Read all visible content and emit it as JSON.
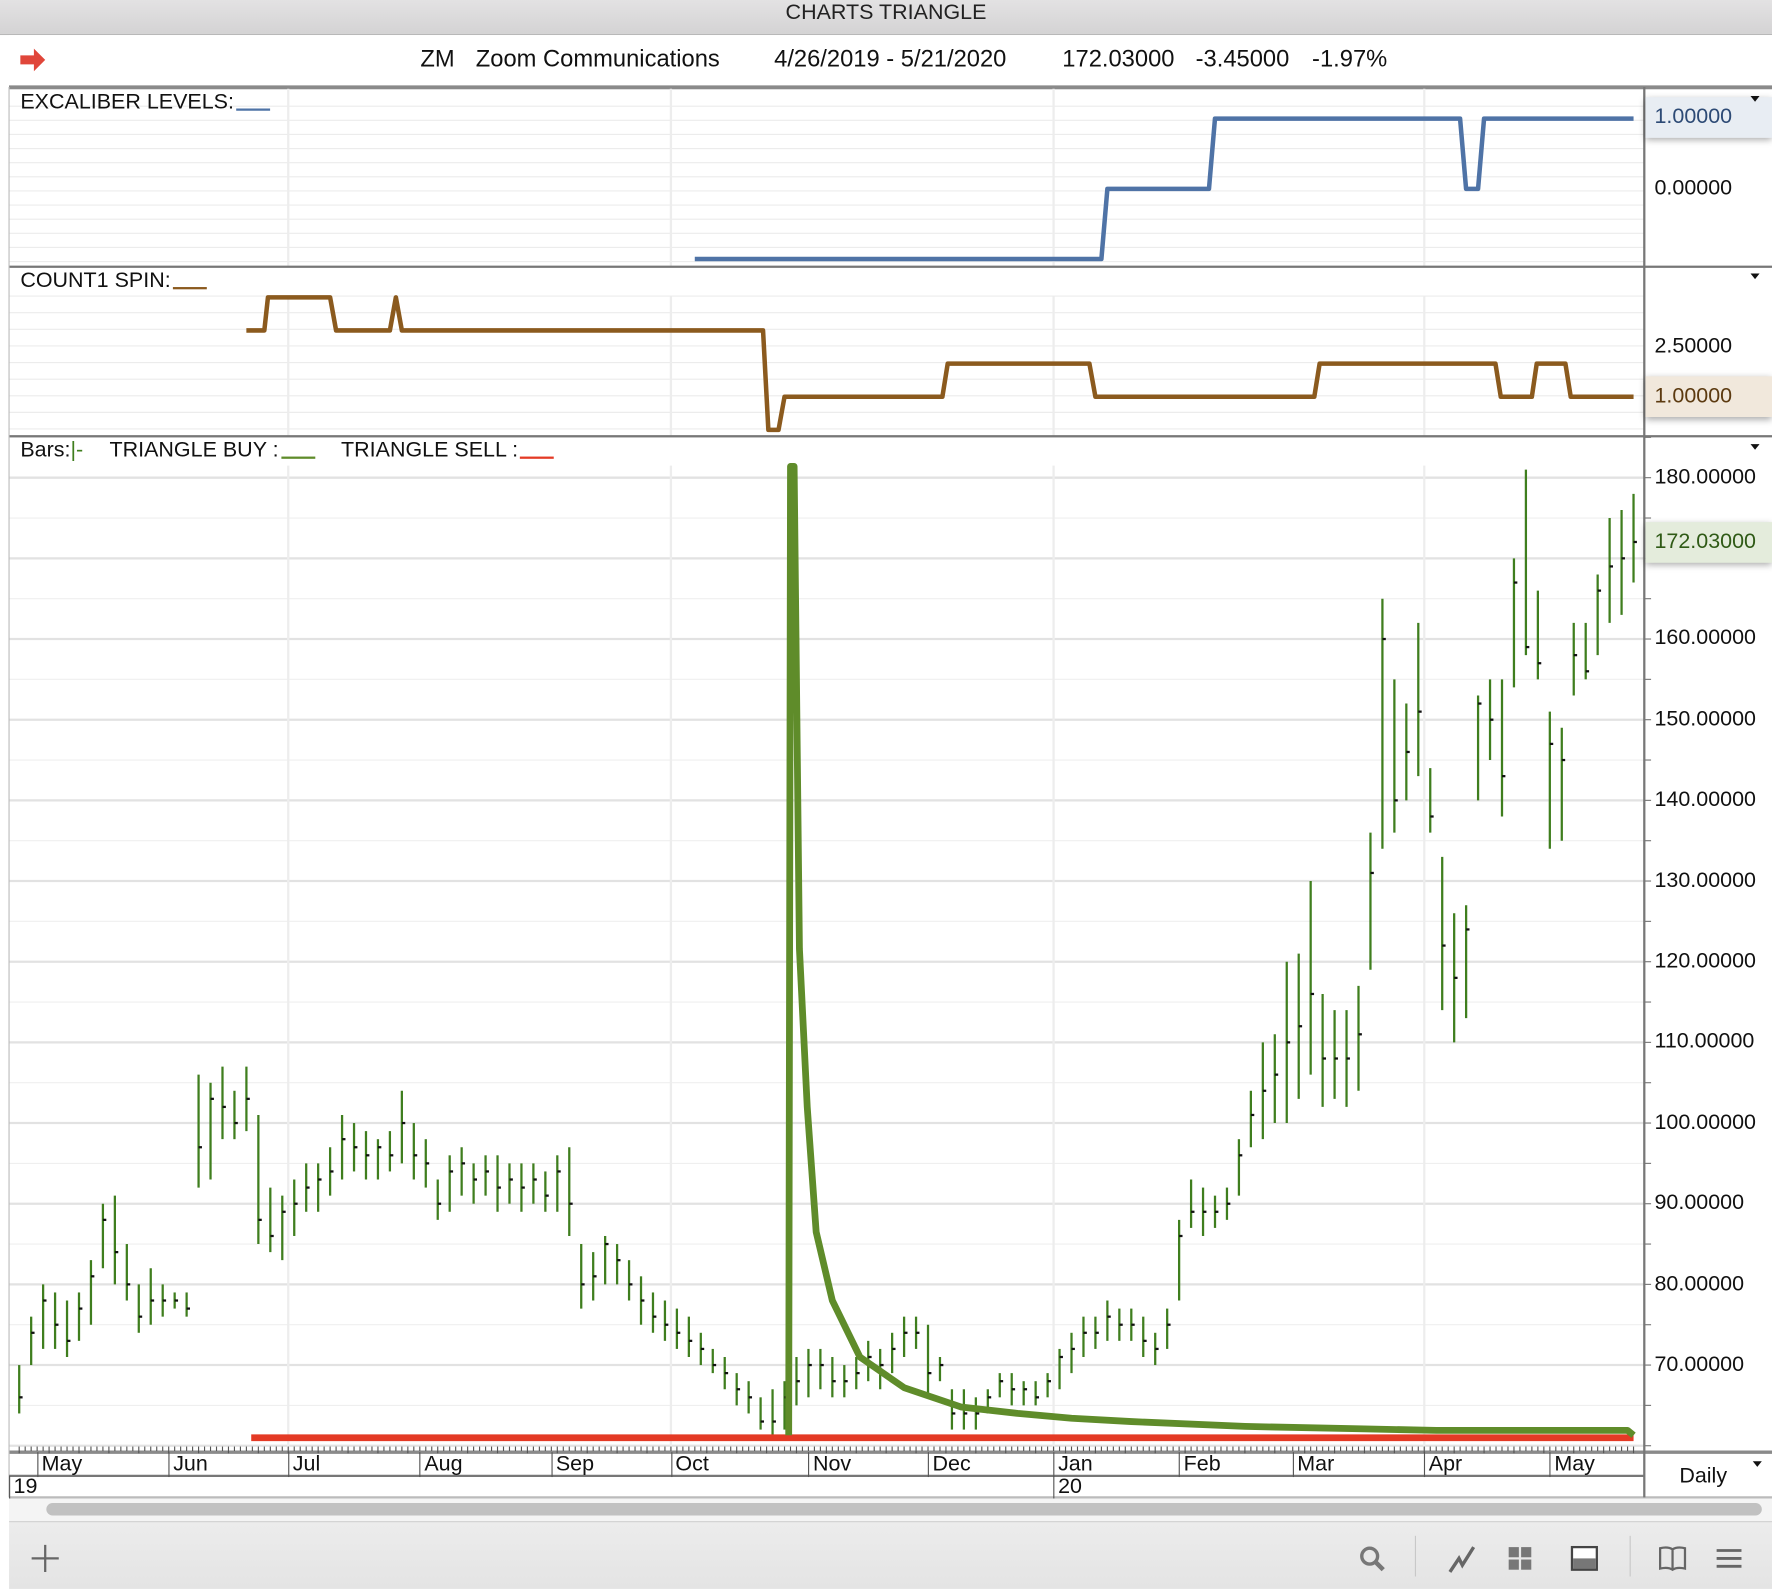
{
  "window_title": "CHARTS TRIANGLE",
  "header": {
    "symbol": "ZM",
    "company": "Zoom Communications",
    "date_range": "4/26/2019 - 5/21/2020",
    "last": "172.03000",
    "change": "-3.45000",
    "change_pct": "-1.97%"
  },
  "panes": {
    "excaliber": {
      "label": "EXCALIBER LEVELS:",
      "axis_labels": [
        "1.00000",
        "0.00000"
      ],
      "current": "1.00000",
      "color": "#4f73a6"
    },
    "count1": {
      "label": "COUNT1 SPIN:",
      "axis_labels": [
        "2.50000",
        "1.00000"
      ],
      "current": "1.00000",
      "color": "#8b5a1e"
    },
    "main": {
      "bars_label": "Bars:",
      "bars_glyph": "|-",
      "buy_label": "TRIANGLE BUY :",
      "sell_label": "TRIANGLE SELL :",
      "current": "172.03000"
    }
  },
  "periodicity": "Daily",
  "colors": {
    "bars": "#3f7e1e",
    "buy": "#5f8c2a",
    "sell": "#e43a25",
    "excaliber": "#4f73a6",
    "count": "#8b5a1e"
  },
  "toolbar": {
    "icons": [
      "plus-icon",
      "search-icon",
      "line-chart-icon",
      "grid-icon",
      "panel-icon",
      "book-icon",
      "menu-icon"
    ]
  },
  "chart_data": [
    {
      "type": "line",
      "title": "EXCALIBER LEVELS",
      "x_unit": "trading day index from 4/26/2019",
      "xlim": [
        -1.7,
        271.8
      ],
      "ylim": [
        -1.11,
        1.435
      ],
      "ticks": [
        1,
        0
      ],
      "points": [
        [
          113,
          -1
        ],
        [
          181,
          -1
        ],
        [
          182,
          0
        ],
        [
          199,
          0
        ],
        [
          200,
          1
        ],
        [
          241,
          1
        ],
        [
          242,
          0
        ],
        [
          244,
          0
        ],
        [
          245,
          1
        ],
        [
          270,
          1
        ]
      ]
    },
    {
      "type": "line",
      "title": "COUNT1 SPIN",
      "xlim": [
        -1.7,
        271.8
      ],
      "ylim": [
        -0.19,
        4.89
      ],
      "ticks": [
        2.5,
        1
      ],
      "points": [
        [
          38,
          3
        ],
        [
          41,
          3
        ],
        [
          41.6,
          4
        ],
        [
          52,
          4
        ],
        [
          53,
          3
        ],
        [
          62,
          3
        ],
        [
          63,
          4
        ],
        [
          64,
          3
        ],
        [
          124.4,
          3
        ],
        [
          125.3,
          0
        ],
        [
          127,
          0
        ],
        [
          128,
          1
        ],
        [
          154.4,
          1
        ],
        [
          155.3,
          2
        ],
        [
          179,
          2
        ],
        [
          180,
          1
        ],
        [
          216.6,
          1
        ],
        [
          217.5,
          2
        ],
        [
          246.9,
          2
        ],
        [
          247.8,
          1
        ],
        [
          253,
          1
        ],
        [
          253.8,
          2
        ],
        [
          258.6,
          2
        ],
        [
          259.5,
          1
        ],
        [
          270,
          1
        ]
      ]
    },
    {
      "type": "bar",
      "subtype": "ohlc",
      "title": "ZM daily bars",
      "xlim": [
        -1.7,
        271.8
      ],
      "ylim": [
        59.2,
        185
      ],
      "y_ticks": [
        180,
        170,
        160,
        150,
        140,
        130,
        120,
        110,
        100,
        90,
        80,
        70
      ],
      "y_tick_labels": [
        "180.00000",
        "170.00000",
        "160.00000",
        "150.00000",
        "140.00000",
        "130.00000",
        "120.00000",
        "110.00000",
        "100.00000",
        "90.00000",
        "80.00000",
        "70.00000"
      ],
      "x_months": [
        {
          "label": "May",
          "day": 3
        },
        {
          "label": "Jun",
          "day": 25
        },
        {
          "label": "Jul",
          "day": 45
        },
        {
          "label": "Aug",
          "day": 67
        },
        {
          "label": "Sep",
          "day": 89
        },
        {
          "label": "Oct",
          "day": 109
        },
        {
          "label": "Nov",
          "day": 132
        },
        {
          "label": "Dec",
          "day": 152
        },
        {
          "label": "Jan",
          "day": 173
        },
        {
          "label": "Feb",
          "day": 194
        },
        {
          "label": "Mar",
          "day": 213
        },
        {
          "label": "Apr",
          "day": 235
        },
        {
          "label": "May",
          "day": 256
        }
      ],
      "x_years": [
        {
          "label": "19",
          "day": -1.7
        },
        {
          "label": "20",
          "day": 173
        }
      ],
      "bar_step_days": 2,
      "bars_hlc": [
        [
          70,
          64,
          66
        ],
        [
          76,
          70,
          74
        ],
        [
          80,
          72,
          78
        ],
        [
          79,
          72,
          75
        ],
        [
          78,
          71,
          73
        ],
        [
          79,
          73,
          77
        ],
        [
          83,
          75,
          81
        ],
        [
          90,
          82,
          88
        ],
        [
          91,
          80,
          84
        ],
        [
          85,
          78,
          80
        ],
        [
          80,
          74,
          76
        ],
        [
          82,
          75,
          78
        ],
        [
          80,
          76,
          78
        ],
        [
          79,
          77,
          78
        ],
        [
          79,
          76,
          77
        ],
        [
          106,
          92,
          97
        ],
        [
          105,
          93,
          103
        ],
        [
          107,
          98,
          102
        ],
        [
          104,
          98,
          100
        ],
        [
          107,
          99,
          103
        ],
        [
          101,
          85,
          88
        ],
        [
          92,
          84,
          86
        ],
        [
          91,
          83,
          89
        ],
        [
          93,
          86,
          90
        ],
        [
          95,
          89,
          92
        ],
        [
          95,
          89,
          93
        ],
        [
          97,
          91,
          94
        ],
        [
          101,
          93,
          98
        ],
        [
          100,
          94,
          97
        ],
        [
          99,
          93,
          96
        ],
        [
          98,
          93,
          97
        ],
        [
          99,
          94,
          96
        ],
        [
          104,
          95,
          100
        ],
        [
          100,
          93,
          96
        ],
        [
          98,
          92,
          95
        ],
        [
          93,
          88,
          90
        ],
        [
          96,
          89,
          94
        ],
        [
          97,
          91,
          95
        ],
        [
          95,
          90,
          93
        ],
        [
          96,
          91,
          94
        ],
        [
          96,
          89,
          92
        ],
        [
          95,
          90,
          93
        ],
        [
          95,
          89,
          92
        ],
        [
          95,
          90,
          93
        ],
        [
          94,
          89,
          91
        ],
        [
          96,
          89,
          94
        ],
        [
          97,
          86,
          90
        ],
        [
          85,
          77,
          80
        ],
        [
          84,
          78,
          81
        ],
        [
          86,
          80,
          85
        ],
        [
          85,
          80,
          83
        ],
        [
          83,
          78,
          80
        ],
        [
          81,
          75,
          78
        ],
        [
          79,
          74,
          76
        ],
        [
          78,
          73,
          75
        ],
        [
          77,
          72,
          74
        ],
        [
          76,
          71,
          73
        ],
        [
          74,
          70,
          72
        ],
        [
          72,
          69,
          70
        ],
        [
          71,
          67,
          69
        ],
        [
          69,
          65,
          67
        ],
        [
          68,
          64,
          66
        ],
        [
          66,
          62,
          63
        ],
        [
          67,
          61,
          63
        ],
        [
          68,
          62,
          66
        ],
        [
          71,
          65,
          68
        ],
        [
          72,
          66,
          70
        ],
        [
          72,
          67,
          70
        ],
        [
          71,
          66,
          68
        ],
        [
          70,
          66,
          68
        ],
        [
          71,
          67,
          69
        ],
        [
          73,
          68,
          71
        ],
        [
          72,
          67,
          70
        ],
        [
          74,
          69,
          72
        ],
        [
          76,
          71,
          74
        ],
        [
          76,
          72,
          74
        ],
        [
          75,
          66,
          69
        ],
        [
          71,
          68,
          70
        ],
        [
          67,
          62,
          64
        ],
        [
          67,
          62,
          64
        ],
        [
          66,
          62,
          64
        ],
        [
          67,
          64,
          66
        ],
        [
          69,
          66,
          68
        ],
        [
          69,
          65,
          67
        ],
        [
          68,
          65,
          67
        ],
        [
          68,
          65,
          66
        ],
        [
          69,
          66,
          68
        ],
        [
          72,
          67,
          71
        ],
        [
          74,
          69,
          72
        ],
        [
          76,
          71,
          74
        ],
        [
          76,
          72,
          74
        ],
        [
          78,
          73,
          76
        ],
        [
          77,
          73,
          75
        ],
        [
          77,
          73,
          75
        ],
        [
          76,
          71,
          73
        ],
        [
          74,
          70,
          72
        ],
        [
          77,
          72,
          75
        ],
        [
          88,
          78,
          86
        ],
        [
          93,
          87,
          89
        ],
        [
          92,
          86,
          89
        ],
        [
          91,
          87,
          89
        ],
        [
          92,
          88,
          90
        ],
        [
          98,
          91,
          96
        ],
        [
          104,
          97,
          101
        ],
        [
          110,
          98,
          104
        ],
        [
          111,
          100,
          106
        ],
        [
          120,
          100,
          110
        ],
        [
          121,
          103,
          112
        ],
        [
          130,
          106,
          116
        ],
        [
          116,
          102,
          108
        ],
        [
          114,
          103,
          108
        ],
        [
          114,
          102,
          108
        ],
        [
          117,
          104,
          111
        ],
        [
          136,
          119,
          131
        ],
        [
          165,
          134,
          160
        ],
        [
          155,
          136,
          140
        ],
        [
          152,
          140,
          146
        ],
        [
          162,
          143,
          151
        ],
        [
          144,
          136,
          138
        ],
        [
          133,
          114,
          122
        ],
        [
          126,
          110,
          118
        ],
        [
          127,
          113,
          124
        ],
        [
          153,
          140,
          152
        ],
        [
          155,
          145,
          150
        ],
        [
          155,
          138,
          143
        ],
        [
          170,
          154,
          167
        ],
        [
          181,
          158,
          159
        ],
        [
          166,
          155,
          157
        ],
        [
          151,
          134,
          147
        ],
        [
          149,
          135,
          145
        ],
        [
          162,
          153,
          158
        ],
        [
          162,
          155,
          156
        ],
        [
          168,
          158,
          166
        ],
        [
          175,
          162,
          169
        ],
        [
          176,
          163,
          170
        ],
        [
          178,
          167,
          172.03
        ]
      ],
      "series": [
        {
          "name": "TRIANGLE BUY",
          "points": [
            [
              128.7,
              61.3
            ],
            [
              129,
              181.4
            ],
            [
              129.6,
              181.4
            ],
            [
              130.5,
              121.6
            ],
            [
              131.8,
              102
            ],
            [
              133.3,
              86.5
            ],
            [
              136,
              78
            ],
            [
              140.6,
              71
            ],
            [
              148,
              67.2
            ],
            [
              157.5,
              64.8
            ],
            [
              167,
              64
            ],
            [
              176,
              63.4
            ],
            [
              186,
              63
            ],
            [
              205,
              62.4
            ],
            [
              224,
              62.1
            ],
            [
              237,
              61.9
            ],
            [
              269,
              61.9
            ],
            [
              270,
              61.3
            ]
          ]
        },
        {
          "name": "TRIANGLE SELL",
          "points": [
            [
              38.8,
              61.0
            ],
            [
              270,
              61.0
            ]
          ]
        }
      ]
    }
  ]
}
